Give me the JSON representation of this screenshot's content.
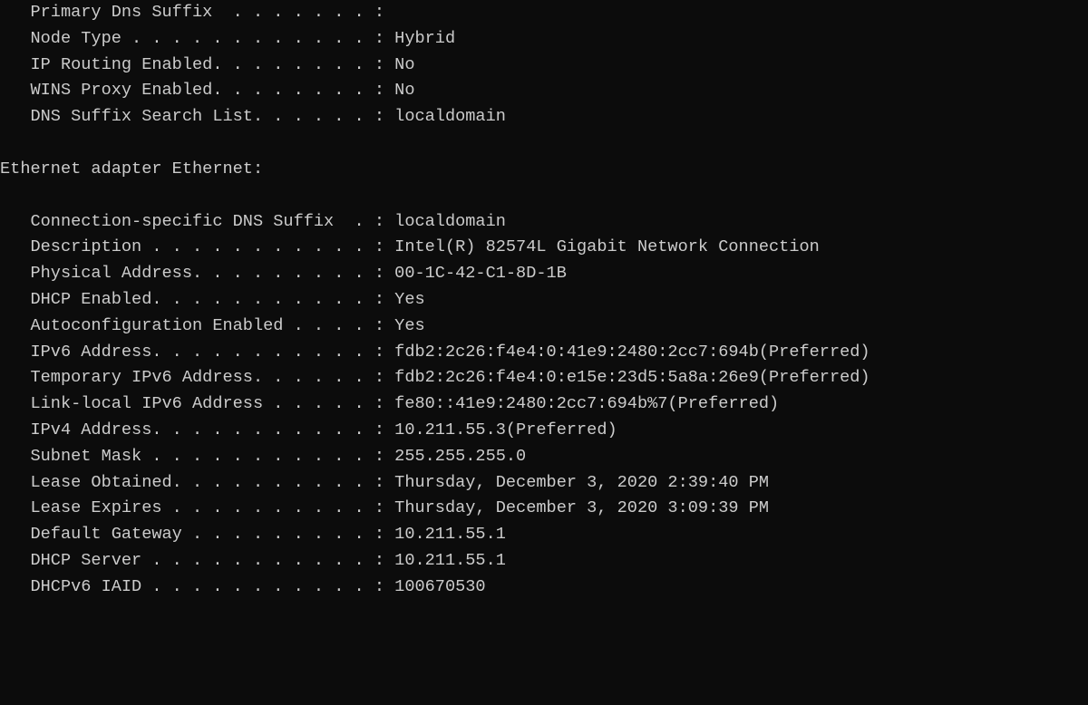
{
  "blank": "",
  "host": {
    "primary_dns_suffix_line": "   Primary Dns Suffix  . . . . . . . :",
    "node_type_line": "   Node Type . . . . . . . . . . . . : Hybrid",
    "ip_routing_line": "   IP Routing Enabled. . . . . . . . : No",
    "wins_proxy_line": "   WINS Proxy Enabled. . . . . . . . : No",
    "dns_suffix_search_line": "   DNS Suffix Search List. . . . . . : localdomain"
  },
  "adapter": {
    "header": "Ethernet adapter Ethernet:",
    "conn_dns_suffix_line": "   Connection-specific DNS Suffix  . : localdomain",
    "description_line": "   Description . . . . . . . . . . . : Intel(R) 82574L Gigabit Network Connection",
    "physical_address_line": "   Physical Address. . . . . . . . . : 00-1C-42-C1-8D-1B",
    "dhcp_enabled_line": "   DHCP Enabled. . . . . . . . . . . : Yes",
    "autoconfig_line": "   Autoconfiguration Enabled . . . . : Yes",
    "ipv6_address_line": "   IPv6 Address. . . . . . . . . . . : fdb2:2c26:f4e4:0:41e9:2480:2cc7:694b(Preferred)",
    "temp_ipv6_line": "   Temporary IPv6 Address. . . . . . : fdb2:2c26:f4e4:0:e15e:23d5:5a8a:26e9(Preferred)",
    "link_local_ipv6_line": "   Link-local IPv6 Address . . . . . : fe80::41e9:2480:2cc7:694b%7(Preferred)",
    "ipv4_address_line": "   IPv4 Address. . . . . . . . . . . : 10.211.55.3(Preferred)",
    "subnet_mask_line": "   Subnet Mask . . . . . . . . . . . : 255.255.255.0",
    "lease_obtained_line": "   Lease Obtained. . . . . . . . . . : Thursday, December 3, 2020 2:39:40 PM",
    "lease_expires_line": "   Lease Expires . . . . . . . . . . : Thursday, December 3, 2020 3:09:39 PM",
    "default_gateway_line": "   Default Gateway . . . . . . . . . : 10.211.55.1",
    "dhcp_server_line": "   DHCP Server . . . . . . . . . . . : 10.211.55.1",
    "dhcpv6_iaid_line": "   DHCPv6 IAID . . . . . . . . . . . : 100670530"
  },
  "values": {
    "node_type": "Hybrid",
    "ip_routing_enabled": "No",
    "wins_proxy_enabled": "No",
    "dns_suffix_search_list": "localdomain",
    "connection_specific_dns_suffix": "localdomain",
    "description": "Intel(R) 82574L Gigabit Network Connection",
    "physical_address": "00-1C-42-C1-8D-1B",
    "dhcp_enabled": "Yes",
    "autoconfiguration_enabled": "Yes",
    "ipv6_address": "fdb2:2c26:f4e4:0:41e9:2480:2cc7:694b(Preferred)",
    "temporary_ipv6_address": "fdb2:2c26:f4e4:0:e15e:23d5:5a8a:26e9(Preferred)",
    "link_local_ipv6_address": "fe80::41e9:2480:2cc7:694b%7(Preferred)",
    "ipv4_address": "10.211.55.3(Preferred)",
    "subnet_mask": "255.255.255.0",
    "lease_obtained": "Thursday, December 3, 2020 2:39:40 PM",
    "lease_expires": "Thursday, December 3, 2020 3:09:39 PM",
    "default_gateway": "10.211.55.1",
    "dhcp_server": "10.211.55.1",
    "dhcpv6_iaid": "100670530"
  }
}
